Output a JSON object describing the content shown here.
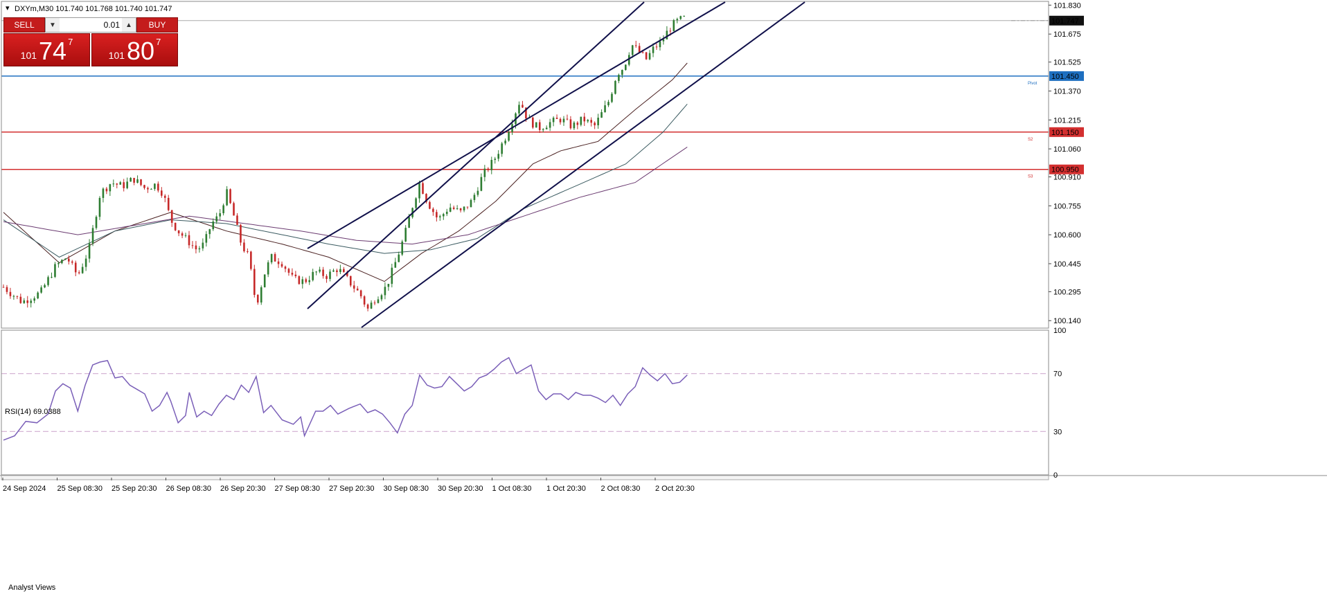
{
  "symbol_header": "DXYm,M30  101.740 101.768 101.740 101.747",
  "trade_panel": {
    "sell_label": "SELL",
    "buy_label": "BUY",
    "volume": "0.01",
    "sell_price": {
      "small": "101",
      "big": "74",
      "sup": "7"
    },
    "buy_price": {
      "small": "101",
      "big": "80",
      "sup": "7"
    }
  },
  "rsi_label": "RSI(14) 69.0388",
  "analyst_views_label": "Analyst Views",
  "colors": {
    "bull": "#2e7d32",
    "bear": "#c62828",
    "pivot": "#1e6fc0",
    "resistance": "#d32f2f",
    "channel": "#10104a",
    "rsi": "#7a5fb8",
    "ma_fast": "#4a2020",
    "ma_mid": "#3a5a60",
    "ma_slow": "#6a3a70"
  },
  "chart_data": [
    {
      "type": "candlestick",
      "title": "DXYm,M30",
      "y_ticks": [
        "101.830",
        "101.675",
        "101.525",
        "101.370",
        "101.215",
        "101.060",
        "100.910",
        "100.755",
        "100.600",
        "100.445",
        "100.295",
        "100.140"
      ],
      "ylim": [
        100.1,
        101.85
      ],
      "x_tick_labels": [
        "24 Sep 2024",
        "25 Sep 08:30",
        "25 Sep 20:30",
        "26 Sep 08:30",
        "26 Sep 20:30",
        "27 Sep 08:30",
        "27 Sep 20:30",
        "30 Sep 08:30",
        "30 Sep 20:30",
        "1 Oct 08:30",
        "1 Oct 20:30",
        "2 Oct 08:30",
        "2 Oct 20:30"
      ],
      "current_price": "101.747",
      "levels": [
        {
          "name": "Pivot",
          "value": 101.45,
          "label": "101.450"
        },
        {
          "name": "S2",
          "value": 101.15,
          "label": "101.150"
        },
        {
          "name": "S3",
          "value": 100.95,
          "label": "100.950"
        }
      ],
      "close_path": [
        [
          0,
          100.32
        ],
        [
          10,
          100.24
        ],
        [
          20,
          100.29
        ],
        [
          28,
          100.43
        ],
        [
          34,
          100.48
        ],
        [
          40,
          100.38
        ],
        [
          46,
          100.52
        ],
        [
          52,
          100.82
        ],
        [
          58,
          100.88
        ],
        [
          64,
          100.86
        ],
        [
          70,
          100.9
        ],
        [
          76,
          100.85
        ],
        [
          82,
          100.87
        ],
        [
          86,
          100.82
        ],
        [
          90,
          100.68
        ],
        [
          94,
          100.62
        ],
        [
          98,
          100.58
        ],
        [
          104,
          100.52
        ],
        [
          108,
          100.55
        ],
        [
          112,
          100.66
        ],
        [
          116,
          100.7
        ],
        [
          120,
          100.83
        ],
        [
          124,
          100.7
        ],
        [
          128,
          100.55
        ],
        [
          132,
          100.48
        ],
        [
          136,
          100.22
        ],
        [
          140,
          100.38
        ],
        [
          144,
          100.48
        ],
        [
          150,
          100.45
        ],
        [
          156,
          100.36
        ],
        [
          162,
          100.35
        ],
        [
          168,
          100.4
        ],
        [
          174,
          100.38
        ],
        [
          180,
          100.42
        ],
        [
          186,
          100.35
        ],
        [
          192,
          100.28
        ],
        [
          196,
          100.2
        ],
        [
          200,
          100.26
        ],
        [
          206,
          100.32
        ],
        [
          212,
          100.48
        ],
        [
          216,
          100.6
        ],
        [
          220,
          100.75
        ],
        [
          224,
          100.88
        ],
        [
          228,
          100.78
        ],
        [
          234,
          100.68
        ],
        [
          240,
          100.75
        ],
        [
          246,
          100.72
        ],
        [
          252,
          100.78
        ],
        [
          258,
          100.92
        ],
        [
          264,
          101.0
        ],
        [
          270,
          101.12
        ],
        [
          274,
          101.22
        ],
        [
          278,
          101.32
        ],
        [
          282,
          101.22
        ],
        [
          288,
          101.17
        ],
        [
          294,
          101.2
        ],
        [
          300,
          101.22
        ],
        [
          306,
          101.18
        ],
        [
          312,
          101.22
        ],
        [
          318,
          101.18
        ],
        [
          322,
          101.25
        ],
        [
          326,
          101.32
        ],
        [
          330,
          101.46
        ],
        [
          334,
          101.5
        ],
        [
          338,
          101.62
        ],
        [
          342,
          101.58
        ],
        [
          346,
          101.54
        ],
        [
          350,
          101.6
        ],
        [
          354,
          101.63
        ],
        [
          358,
          101.7
        ],
        [
          362,
          101.74
        ],
        [
          366,
          101.76
        ],
        [
          368,
          101.747
        ]
      ],
      "moving_averages": {
        "ma_fast": [
          [
            0,
            100.72
          ],
          [
            30,
            100.45
          ],
          [
            60,
            100.62
          ],
          [
            90,
            100.72
          ],
          [
            120,
            100.62
          ],
          [
            150,
            100.55
          ],
          [
            175,
            100.48
          ],
          [
            205,
            100.35
          ],
          [
            225,
            100.5
          ],
          [
            245,
            100.62
          ],
          [
            265,
            100.78
          ],
          [
            285,
            100.98
          ],
          [
            300,
            101.05
          ],
          [
            320,
            101.1
          ],
          [
            340,
            101.27
          ],
          [
            360,
            101.43
          ],
          [
            368,
            101.52
          ]
        ],
        "ma_mid": [
          [
            0,
            100.68
          ],
          [
            30,
            100.48
          ],
          [
            60,
            100.62
          ],
          [
            90,
            100.68
          ],
          [
            120,
            100.66
          ],
          [
            150,
            100.6
          ],
          [
            175,
            100.55
          ],
          [
            205,
            100.5
          ],
          [
            230,
            100.52
          ],
          [
            255,
            100.58
          ],
          [
            280,
            100.74
          ],
          [
            310,
            100.87
          ],
          [
            335,
            100.98
          ],
          [
            355,
            101.15
          ],
          [
            368,
            101.3
          ]
        ],
        "ma_slow": [
          [
            0,
            100.67
          ],
          [
            40,
            100.6
          ],
          [
            70,
            100.65
          ],
          [
            100,
            100.7
          ],
          [
            130,
            100.66
          ],
          [
            160,
            100.62
          ],
          [
            190,
            100.57
          ],
          [
            220,
            100.55
          ],
          [
            250,
            100.6
          ],
          [
            280,
            100.7
          ],
          [
            310,
            100.8
          ],
          [
            340,
            100.88
          ],
          [
            368,
            101.07
          ]
        ]
      },
      "channel_lines": [
        {
          "from": [
            164,
            100.18
          ],
          "to": [
            346,
            101.85
          ]
        },
        {
          "from": [
            164,
            100.52
          ],
          "to": [
            346,
            101.85
          ],
          "note": "mid"
        },
        {
          "from": [
            194,
            100.12
          ],
          "to": [
            432,
            101.85
          ]
        }
      ]
    },
    {
      "type": "line",
      "title": "RSI(14) 69.0388",
      "y_ticks": [
        "100",
        "70",
        "30",
        "0"
      ],
      "ylim": [
        0,
        100
      ],
      "reference_levels": [
        70,
        30
      ],
      "values": [
        [
          0,
          24
        ],
        [
          6,
          27
        ],
        [
          12,
          37
        ],
        [
          18,
          36
        ],
        [
          24,
          42
        ],
        [
          28,
          58
        ],
        [
          32,
          63
        ],
        [
          36,
          60
        ],
        [
          40,
          44
        ],
        [
          44,
          62
        ],
        [
          48,
          76
        ],
        [
          52,
          78
        ],
        [
          56,
          79
        ],
        [
          60,
          67
        ],
        [
          64,
          68
        ],
        [
          68,
          62
        ],
        [
          72,
          59
        ],
        [
          76,
          56
        ],
        [
          80,
          44
        ],
        [
          84,
          48
        ],
        [
          88,
          57
        ],
        [
          90,
          51
        ],
        [
          94,
          36
        ],
        [
          98,
          41
        ],
        [
          100,
          57
        ],
        [
          104,
          40
        ],
        [
          108,
          44
        ],
        [
          112,
          41
        ],
        [
          116,
          49
        ],
        [
          120,
          55
        ],
        [
          124,
          52
        ],
        [
          128,
          62
        ],
        [
          132,
          57
        ],
        [
          136,
          68
        ],
        [
          140,
          43
        ],
        [
          144,
          48
        ],
        [
          150,
          38
        ],
        [
          156,
          35
        ],
        [
          160,
          40
        ],
        [
          162,
          27
        ],
        [
          168,
          44
        ],
        [
          172,
          44
        ],
        [
          176,
          48
        ],
        [
          180,
          42
        ],
        [
          186,
          46
        ],
        [
          192,
          49
        ],
        [
          196,
          43
        ],
        [
          200,
          45
        ],
        [
          204,
          42
        ],
        [
          208,
          36
        ],
        [
          212,
          29
        ],
        [
          216,
          42
        ],
        [
          220,
          48
        ],
        [
          224,
          69
        ],
        [
          228,
          62
        ],
        [
          232,
          60
        ],
        [
          236,
          61
        ],
        [
          240,
          68
        ],
        [
          244,
          63
        ],
        [
          248,
          58
        ],
        [
          252,
          61
        ],
        [
          256,
          67
        ],
        [
          260,
          69
        ],
        [
          264,
          73
        ],
        [
          268,
          78
        ],
        [
          272,
          81
        ],
        [
          276,
          70
        ],
        [
          280,
          73
        ],
        [
          284,
          76
        ],
        [
          288,
          58
        ],
        [
          292,
          52
        ],
        [
          296,
          56
        ],
        [
          300,
          56
        ],
        [
          304,
          52
        ],
        [
          308,
          57
        ],
        [
          312,
          55
        ],
        [
          316,
          55
        ],
        [
          320,
          53
        ],
        [
          324,
          50
        ],
        [
          328,
          55
        ],
        [
          332,
          48
        ],
        [
          336,
          56
        ],
        [
          340,
          61
        ],
        [
          344,
          74
        ],
        [
          348,
          69
        ],
        [
          352,
          65
        ],
        [
          356,
          70
        ],
        [
          360,
          63
        ],
        [
          364,
          64
        ],
        [
          368,
          69.04
        ]
      ]
    }
  ]
}
